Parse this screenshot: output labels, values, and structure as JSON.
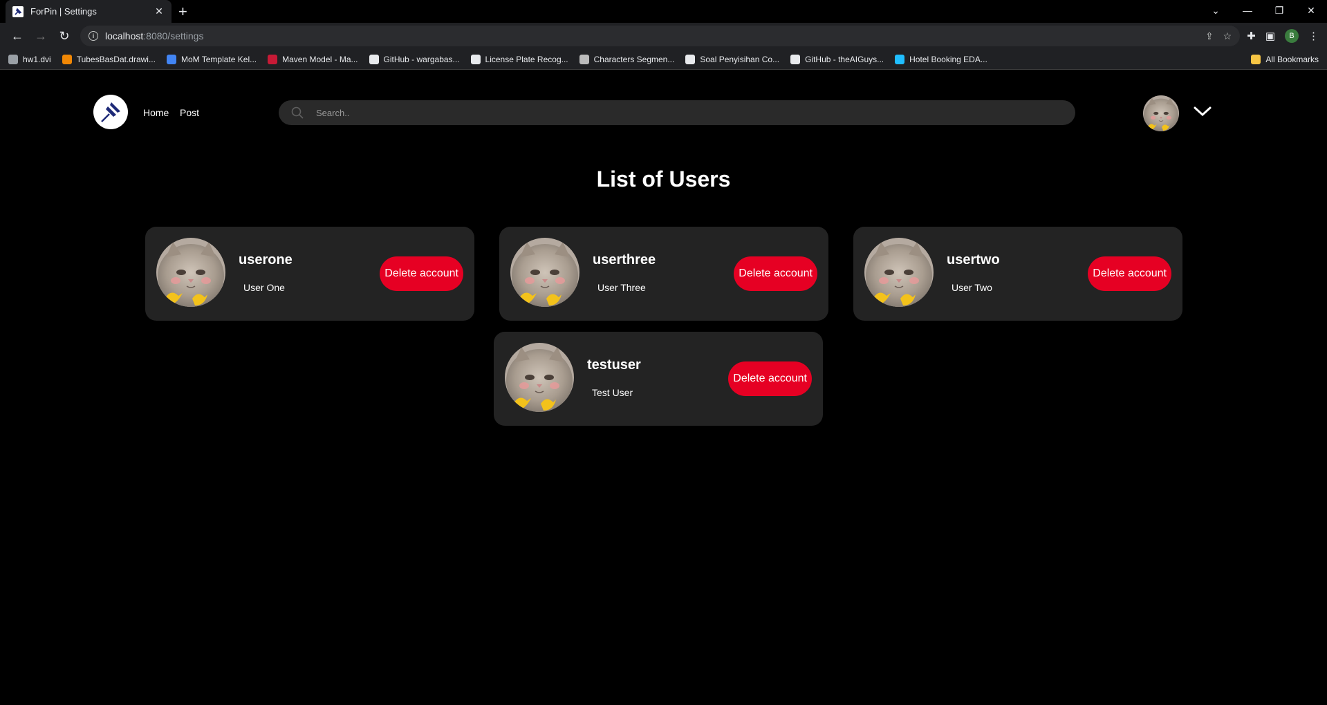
{
  "browser": {
    "tab_title": "ForPin | Settings",
    "url_host": "localhost",
    "url_path": ":8080/settings",
    "profile_initial": "B",
    "bookmarks": [
      {
        "label": "hw1.dvi",
        "color": "#9aa0a6"
      },
      {
        "label": "TubesBasDat.drawi...",
        "color": "#f08705"
      },
      {
        "label": "MoM Template Kel...",
        "color": "#4285f4"
      },
      {
        "label": "Maven Model - Ma...",
        "color": "#c71a36"
      },
      {
        "label": "GitHub - wargabas...",
        "color": "#e8eaed"
      },
      {
        "label": "License Plate Recog...",
        "color": "#e8eaed"
      },
      {
        "label": "Characters Segmen...",
        "color": "#bbbbbb"
      },
      {
        "label": "Soal Penyisihan Co...",
        "color": "#e8eaed"
      },
      {
        "label": "GitHub - theAIGuys...",
        "color": "#e8eaed"
      },
      {
        "label": "Hotel Booking EDA...",
        "color": "#20beff"
      }
    ],
    "all_bookmarks": "All Bookmarks"
  },
  "header": {
    "nav_home": "Home",
    "nav_post": "Post",
    "search_placeholder": "Search.."
  },
  "main": {
    "title": "List of Users",
    "delete_label": "Delete account",
    "users": [
      {
        "username": "userone",
        "fullname": "User One"
      },
      {
        "username": "userthree",
        "fullname": "User Three"
      },
      {
        "username": "usertwo",
        "fullname": "User Two"
      },
      {
        "username": "testuser",
        "fullname": "Test User"
      }
    ]
  },
  "colors": {
    "accent": "#e60023",
    "card": "#232323",
    "background": "#000000"
  }
}
